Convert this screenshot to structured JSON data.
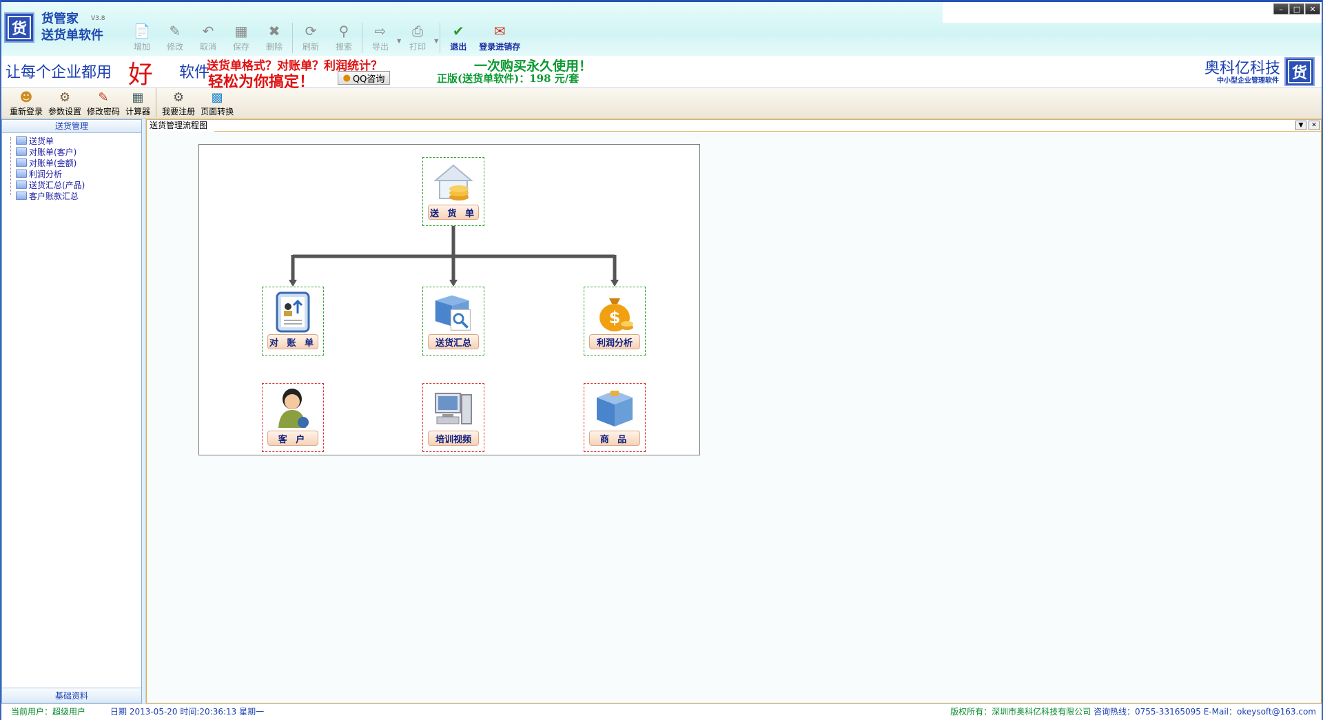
{
  "header": {
    "app_name_1": "货管家",
    "app_name_2": "送货单软件",
    "version": "V3.8",
    "toolbar": [
      {
        "label": "增加",
        "icon": "new-document-icon"
      },
      {
        "label": "修改",
        "icon": "edit-icon"
      },
      {
        "label": "取消",
        "icon": "undo-icon"
      },
      {
        "label": "保存",
        "icon": "save-icon"
      },
      {
        "label": "删除",
        "icon": "delete-icon"
      },
      {
        "label": "刷新",
        "icon": "refresh-icon"
      },
      {
        "label": "搜索",
        "icon": "search-icon"
      },
      {
        "label": "导出",
        "icon": "export-icon"
      },
      {
        "label": "打印",
        "icon": "print-icon"
      },
      {
        "label": "退出",
        "icon": "exit-icon"
      },
      {
        "label": "登录进销存",
        "icon": "login-icon"
      }
    ]
  },
  "banner": {
    "slogan": "让每个企业都用",
    "good": "好",
    "soft": "软件",
    "question": "送货单格式？对账单？利润统计？",
    "easy": "轻松为你搞定！",
    "qq": "QQ咨询",
    "buy": "一次购买永久使用！",
    "price": "正版(送货单软件)：198 元/套",
    "company": "奥科亿科技",
    "company_sub": "中小型企业管理软件"
  },
  "toolbar2": [
    {
      "label": "重新登录",
      "icon": "relogin-icon"
    },
    {
      "label": "参数设置",
      "icon": "settings-icon"
    },
    {
      "label": "修改密码",
      "icon": "password-icon"
    },
    {
      "label": "计算器",
      "icon": "calculator-icon"
    },
    {
      "label": "我要注册",
      "icon": "register-icon"
    },
    {
      "label": "页面转换",
      "icon": "switch-page-icon"
    }
  ],
  "sidebar": {
    "title": "送货管理",
    "items": [
      "送货单",
      "对账单(客户)",
      "对账单(金额)",
      "利润分析",
      "送货汇总(产品)",
      "客户账款汇总"
    ],
    "footer": "基础资料"
  },
  "main": {
    "tab": "送货管理流程图",
    "nodes": {
      "delivery": "送 货 单",
      "statement": "对 账 单",
      "summary": "送货汇总",
      "profit": "利润分析",
      "customer": "客 户",
      "training": "培训视频",
      "product": "商 品"
    }
  },
  "status": {
    "user": "当前用户：超级用户",
    "datetime": "日期 2013-05-20 时间:20:36:13 星期一",
    "copyright": "版权所有：深圳市奥科亿科技有限公司",
    "hotline": "咨询热线：0755-33165095 E-Mail：okeysoft@163.com"
  }
}
